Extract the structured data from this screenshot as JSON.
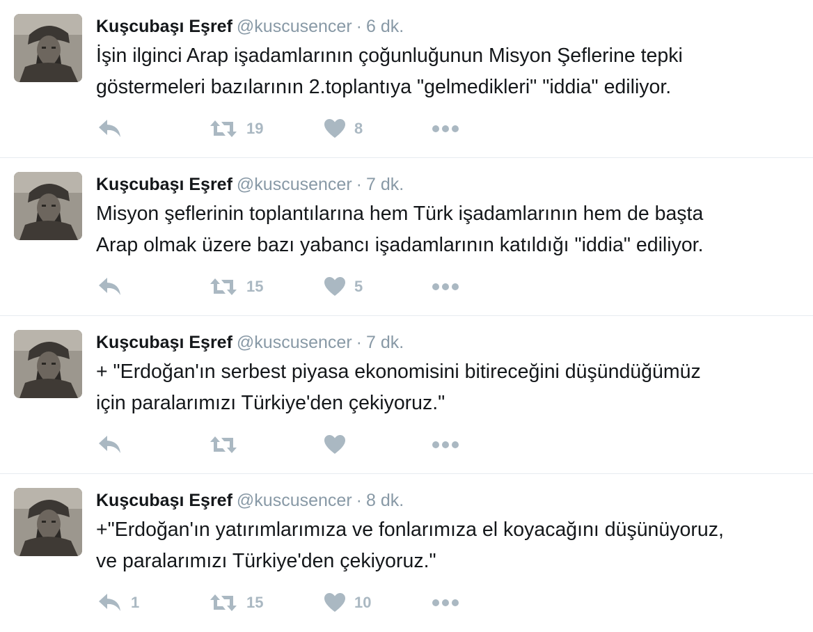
{
  "tweets": [
    {
      "fullname": "Kuşcubaşı Eşref",
      "username": "@kuscusencer",
      "separator": "·",
      "time": "6 dk.",
      "text": "İşin ilginci Arap işadamlarının çoğunluğunun Misyon Şeflerine tepki\ngöstermeleri bazılarının 2.toplantıya \"gelmedikleri\"  \"iddia\" ediliyor.",
      "reply_count": "",
      "retweet_count": "19",
      "like_count": "8"
    },
    {
      "fullname": "Kuşcubaşı Eşref",
      "username": "@kuscusencer",
      "separator": "·",
      "time": "7 dk.",
      "text": "Misyon şeflerinin toplantılarına hem Türk işadamlarının hem de başta\nArap olmak üzere bazı yabancı işadamlarının katıldığı \"iddia\" ediliyor.",
      "reply_count": "",
      "retweet_count": "15",
      "like_count": "5"
    },
    {
      "fullname": "Kuşcubaşı Eşref",
      "username": "@kuscusencer",
      "separator": "·",
      "time": "7 dk.",
      "text": "+ \"Erdoğan'ın serbest piyasa ekonomisini bitireceğini düşündüğümüz\niçin paralarımızı Türkiye'den çekiyoruz.\"",
      "reply_count": "",
      "retweet_count": "",
      "like_count": ""
    },
    {
      "fullname": "Kuşcubaşı Eşref",
      "username": "@kuscusencer",
      "separator": "·",
      "time": "8 dk.",
      "text": "+\"Erdoğan'ın yatırımlarımıza ve fonlarımıza el koyacağını düşünüyoruz,\nve paralarımızı Türkiye'den çekiyoruz.\"",
      "reply_count": "1",
      "retweet_count": "15",
      "like_count": "10"
    }
  ],
  "icons": {
    "reply": "reply-icon",
    "retweet": "retweet-icon",
    "like": "heart-icon",
    "more": "more-dots-icon",
    "avatar": "avatar"
  },
  "colors": {
    "name": "#14171a",
    "meta": "#8899a6",
    "action": "#aab8c2",
    "divider": "#e6ecf0"
  }
}
